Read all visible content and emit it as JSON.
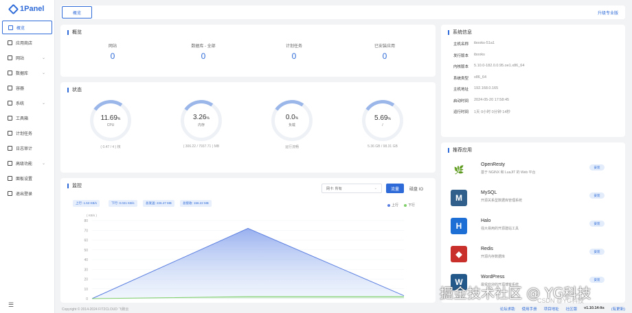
{
  "brand": "1Panel",
  "sidebar": {
    "items": [
      {
        "label": "概览",
        "active": true,
        "chevron": false,
        "icon": "home-icon"
      },
      {
        "label": "应用商店",
        "chevron": false,
        "icon": "store-icon"
      },
      {
        "label": "网站",
        "chevron": true,
        "icon": "globe-icon"
      },
      {
        "label": "数据库",
        "chevron": true,
        "icon": "database-icon"
      },
      {
        "label": "容器",
        "chevron": false,
        "icon": "container-icon"
      },
      {
        "label": "系统",
        "chevron": true,
        "icon": "system-icon"
      },
      {
        "label": "工具箱",
        "chevron": false,
        "icon": "toolbox-icon"
      },
      {
        "label": "计划任务",
        "chevron": false,
        "icon": "schedule-icon"
      },
      {
        "label": "日志审计",
        "chevron": false,
        "icon": "log-icon"
      },
      {
        "label": "高级功能",
        "chevron": true,
        "icon": "advanced-icon"
      },
      {
        "label": "面板设置",
        "chevron": false,
        "icon": "settings-icon"
      },
      {
        "label": "退出登录",
        "chevron": false,
        "icon": "logout-icon"
      }
    ]
  },
  "header": {
    "tab": "概览",
    "upgrade": "升级专业版"
  },
  "overview": {
    "title": "概览",
    "items": [
      {
        "label": "网站",
        "value": "0"
      },
      {
        "label": "数据库 - 全部",
        "value": "0"
      },
      {
        "label": "计划任务",
        "value": "0"
      },
      {
        "label": "已安装应用",
        "value": "0"
      }
    ]
  },
  "status": {
    "title": "状态",
    "gauges": [
      {
        "value": "11.69",
        "unit": "%",
        "label": "CPU",
        "detail": "( 0.47 / 4 ) 核",
        "fraction": 0.1169
      },
      {
        "value": "3.26",
        "unit": "%",
        "label": "内存",
        "detail": "( 306.22 / 7937.71 ) MB",
        "fraction": 0.0326
      },
      {
        "value": "0.0",
        "unit": "%",
        "label": "负载",
        "detail": "运行流畅",
        "fraction": 0.0
      },
      {
        "value": "5.69",
        "unit": "%",
        "label": "/",
        "detail": "5.36 GB / 98.31 GB",
        "fraction": 0.0569
      }
    ]
  },
  "monitor": {
    "title": "监控",
    "select": "网卡: 所有",
    "btn_traffic": "流量",
    "btn_disk": "磁盘 IO",
    "pills": [
      "上行: 1.53 KB/s",
      "下行: 0.021 KB/s",
      "总发送: 226.47 MB",
      "总接收: 156.22 MB"
    ],
    "legend": [
      {
        "name": "上行",
        "color": "#5b7fe0"
      },
      {
        "name": "下行",
        "color": "#7fcf6a"
      }
    ],
    "unit": "( KB/s )",
    "y_ticks": [
      "80",
      "70",
      "60",
      "50",
      "40",
      "30",
      "20",
      "10",
      "0"
    ]
  },
  "chart_data": {
    "type": "area",
    "ylabel": "( KB/s )",
    "ylim": [
      0,
      80
    ],
    "x": [
      0,
      1,
      2
    ],
    "series": [
      {
        "name": "上行",
        "values": [
          0,
          72,
          3
        ],
        "color": "#5b7fe0"
      },
      {
        "name": "下行",
        "values": [
          0,
          2,
          2
        ],
        "color": "#7fcf6a"
      }
    ]
  },
  "sysinfo": {
    "title": "系统信息",
    "rows": [
      {
        "k": "主机名称",
        "v": "ibooks-51a1"
      },
      {
        "k": "发行版本",
        "v": "ibooks"
      },
      {
        "k": "内核版本",
        "v": "5.10.0-182.0.0.95.oe1.x86_64"
      },
      {
        "k": "系统类型",
        "v": "x86_64"
      },
      {
        "k": "主机地址",
        "v": "192.168.0.165"
      },
      {
        "k": "启动时间",
        "v": "2024-05-20 17:58:45"
      },
      {
        "k": "运行时间",
        "v": "1天 0小时 0分钟 14秒"
      }
    ]
  },
  "apps": {
    "title": "推荐应用",
    "install": "安装",
    "list": [
      {
        "name": "OpenResty",
        "desc": "基于 NGINX 和 LuaJIT 的 Web 平台",
        "color": "#fff",
        "glyph": "🌿",
        "fg": "#3a9a3a"
      },
      {
        "name": "MySQL",
        "desc": "开源关系型数据库管理系统",
        "color": "#2f5f8a",
        "glyph": "M",
        "fg": "#fff"
      },
      {
        "name": "Halo",
        "desc": "强大易用的开源建站工具",
        "color": "#1d6fd6",
        "glyph": "H",
        "fg": "#fff"
      },
      {
        "name": "Redis",
        "desc": "开源内存数据库",
        "color": "#c9302c",
        "glyph": "◆",
        "fg": "#fff"
      },
      {
        "name": "WordPress",
        "desc": "最受欢迎的开源博客系统",
        "color": "#23588a",
        "glyph": "W",
        "fg": "#fff"
      }
    ]
  },
  "footer": {
    "copyright": "Copyright © 2014-2024 FIT2CLOUD 飞致云",
    "links": [
      "论坛求助",
      "使用手册",
      "项目地址",
      "社区版",
      "v1.10.14-lts",
      "(有更新)"
    ]
  },
  "watermark": {
    "main": "掘金技术社区 @ YG科技",
    "small": "CSDN @YG科技"
  }
}
